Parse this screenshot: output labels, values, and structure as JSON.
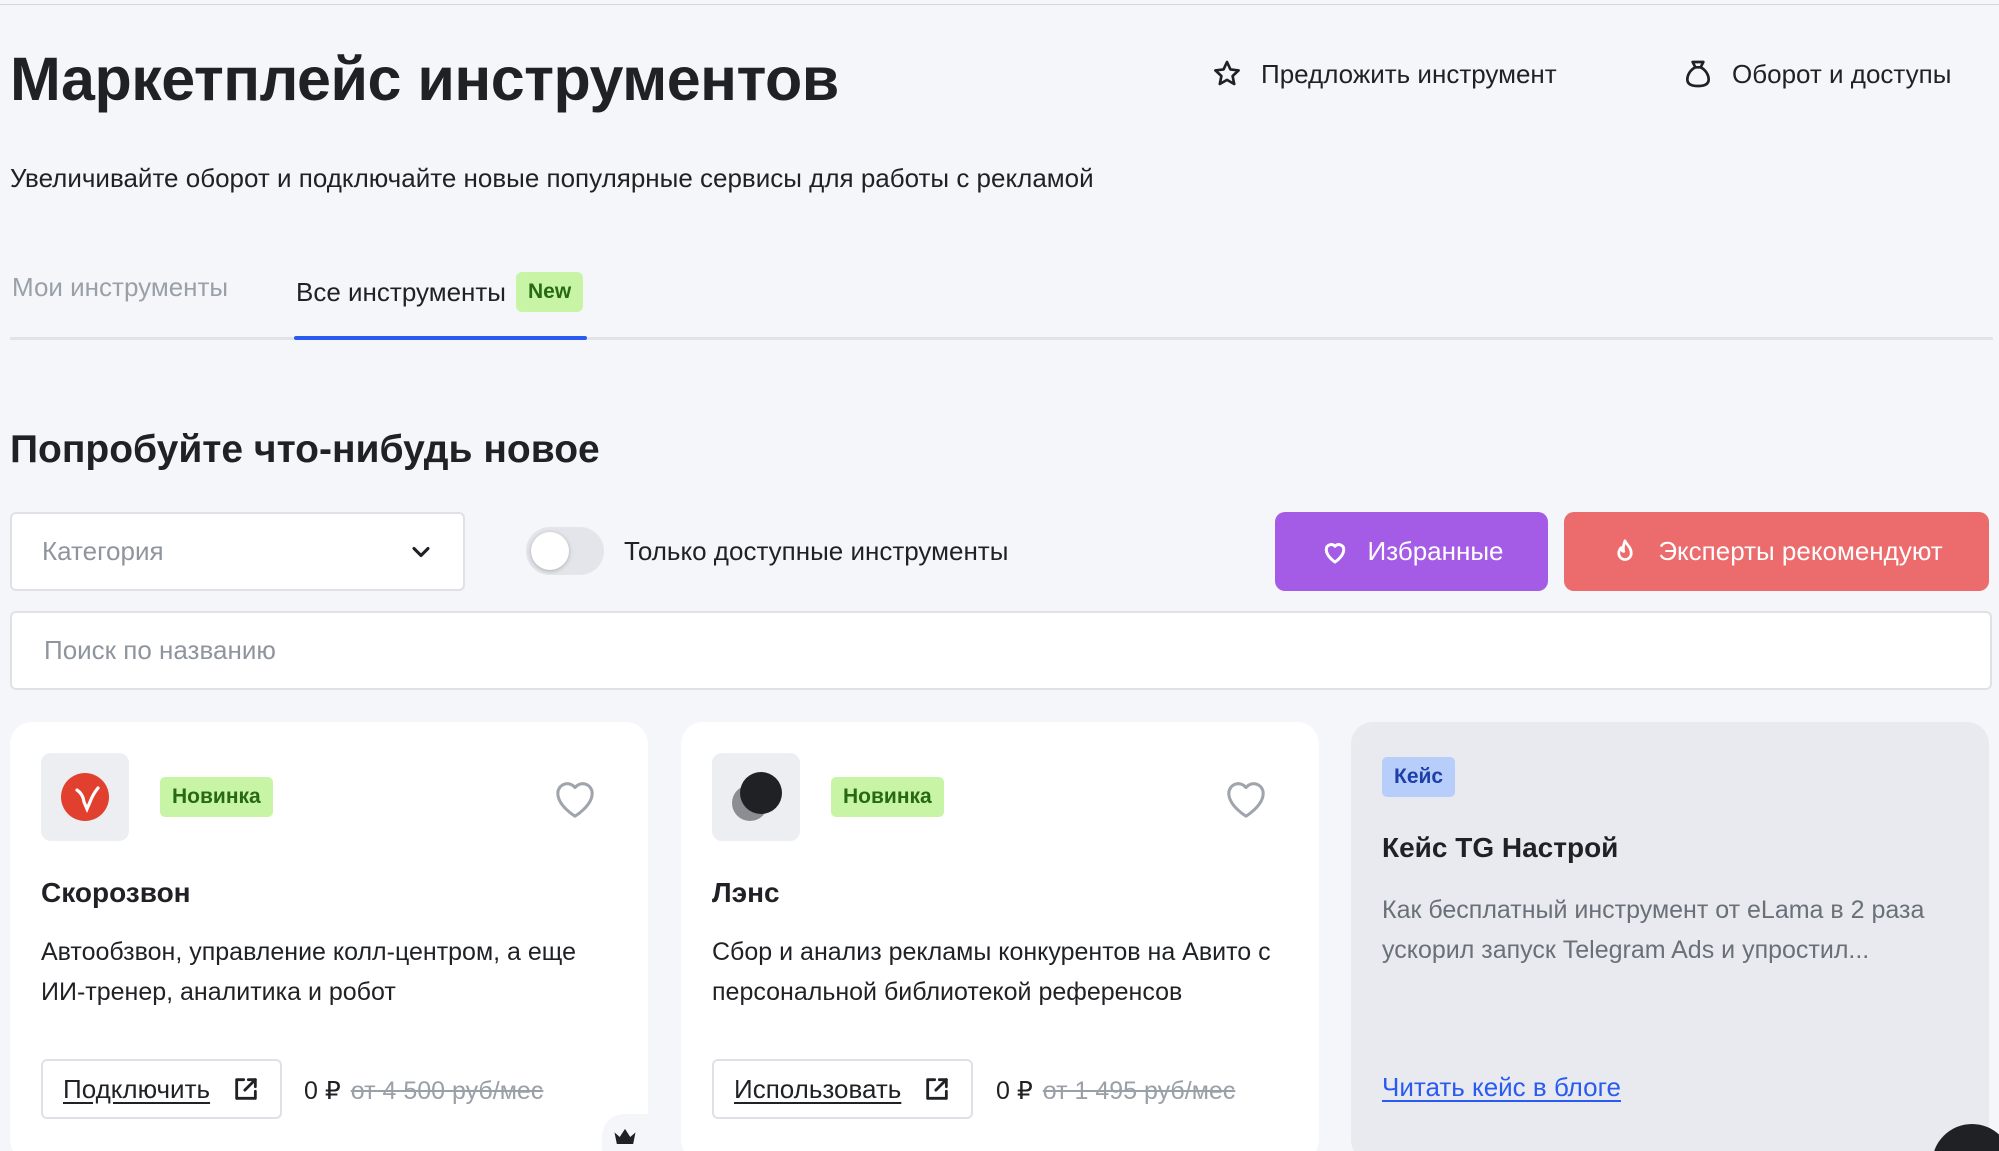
{
  "header": {
    "title": "Маркетплейс инструментов",
    "subtitle": "Увеличивайте оборот и подключайте новые популярные сервисы для работы с рекламой",
    "actions": {
      "suggest": "Предложить инструмент",
      "turnover": "Оборот и доступы"
    }
  },
  "tabs": {
    "my": "Мои инструменты",
    "all": "Все инструменты",
    "all_badge": "New"
  },
  "section": {
    "title": "Попробуйте что-нибудь новое"
  },
  "filters": {
    "category_placeholder": "Категория",
    "toggle_label": "Только доступные инструменты",
    "toggle_on": false,
    "favorites": "Избранные",
    "experts": "Эксперты рекомендуют",
    "search_placeholder": "Поиск по названию"
  },
  "colors": {
    "accent_blue": "#2a5bf0",
    "favorites_purple": "#a45be6",
    "experts_red": "#ec6b6d",
    "badge_green": "#c8f5a5"
  },
  "cards": [
    {
      "badge": "Новинка",
      "title": "Скорозвон",
      "description": "Автообзвон, управление колл-центром, а еще ИИ-тренер, аналитика и робот",
      "button": "Подключить",
      "price": "0 ₽",
      "old_price": "от 4 500 руб/мес",
      "logo_icon": "skorozvon-logo-icon",
      "favorite_icon": "heart-outline-icon"
    },
    {
      "badge": "Новинка",
      "title": "Лэнс",
      "description": "Сбор и анализ рекламы конкурентов на Авито с персональной библиотекой референсов",
      "button": "Использовать",
      "price": "0 ₽",
      "old_price": "от 1 495 руб/мес",
      "logo_icon": "lens-logo-icon",
      "favorite_icon": "heart-outline-icon"
    }
  ],
  "case_card": {
    "badge": "Кейс",
    "title": "Кейс TG Настрой",
    "description": "Как бесплатный инструмент от eLama в 2 раза ускорил запуск Telegram Ads и упростил...",
    "link": "Читать кейс в блоге"
  }
}
